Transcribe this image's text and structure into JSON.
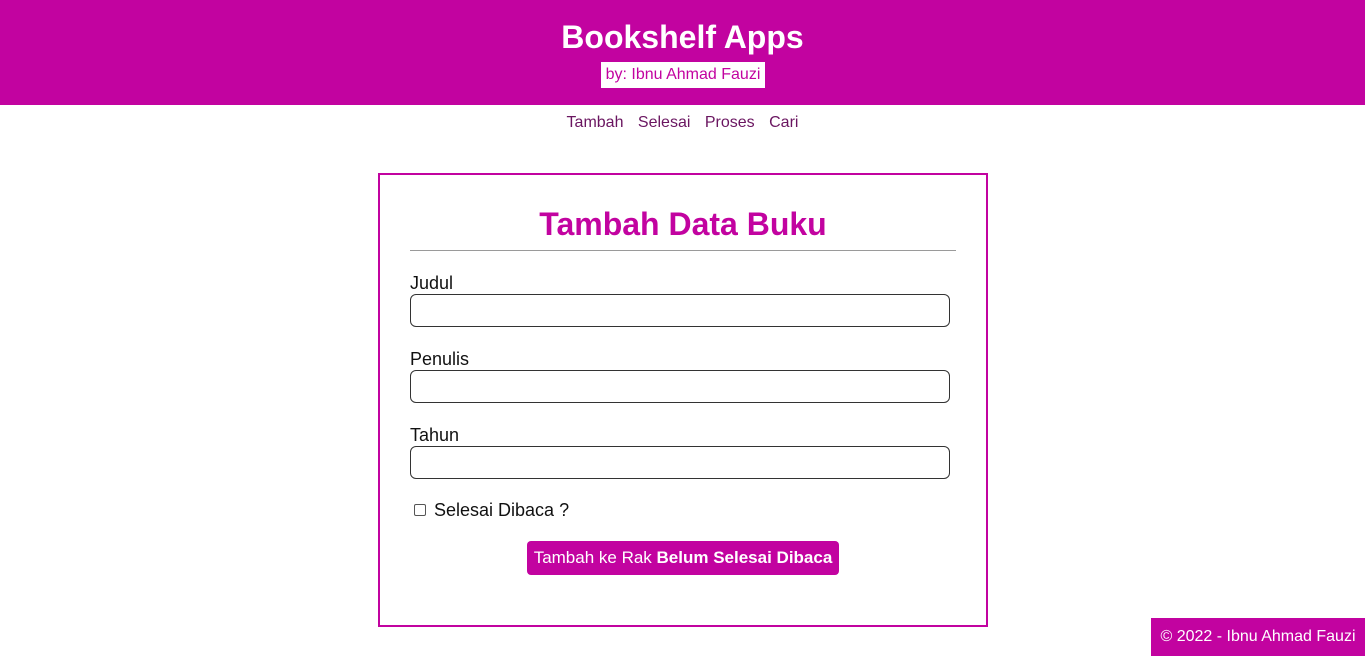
{
  "header": {
    "title": "Bookshelf Apps",
    "author": "by: Ibnu Ahmad Fauzi"
  },
  "nav": {
    "items": [
      "Tambah",
      "Selesai",
      "Proses",
      "Cari"
    ]
  },
  "form": {
    "title": "Tambah Data Buku",
    "fields": [
      {
        "label": "Judul",
        "value": ""
      },
      {
        "label": "Penulis",
        "value": ""
      },
      {
        "label": "Tahun",
        "value": ""
      }
    ],
    "checkbox": {
      "label": "Selesai Dibaca ?",
      "checked": false
    },
    "submit": {
      "prefix": "Tambah ke Rak ",
      "bold": "Belum Selesai Dibaca"
    }
  },
  "footer": {
    "text": "© 2022 - Ibnu Ahmad Fauzi"
  },
  "colors": {
    "accent": "#c203a0",
    "nav_link": "#6a1560"
  }
}
